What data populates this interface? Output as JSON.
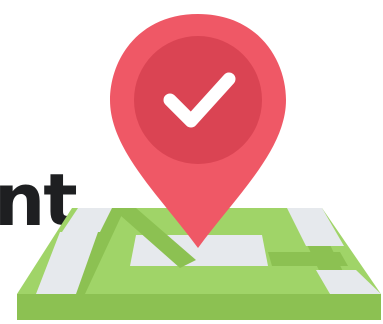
{
  "cropped_text": "nt",
  "illustration": {
    "icons": [
      "location-pin-icon",
      "checkmark-icon",
      "map-icon"
    ],
    "colors": {
      "pin": "#ef5866",
      "pin_inner": "#da4453",
      "check": "#ffffff",
      "map_green": "#a0d468",
      "map_dark_green": "#8cc152",
      "map_road": "#e6e9ed",
      "map_edge": "#8cc152",
      "text": "#1e1f21"
    }
  }
}
